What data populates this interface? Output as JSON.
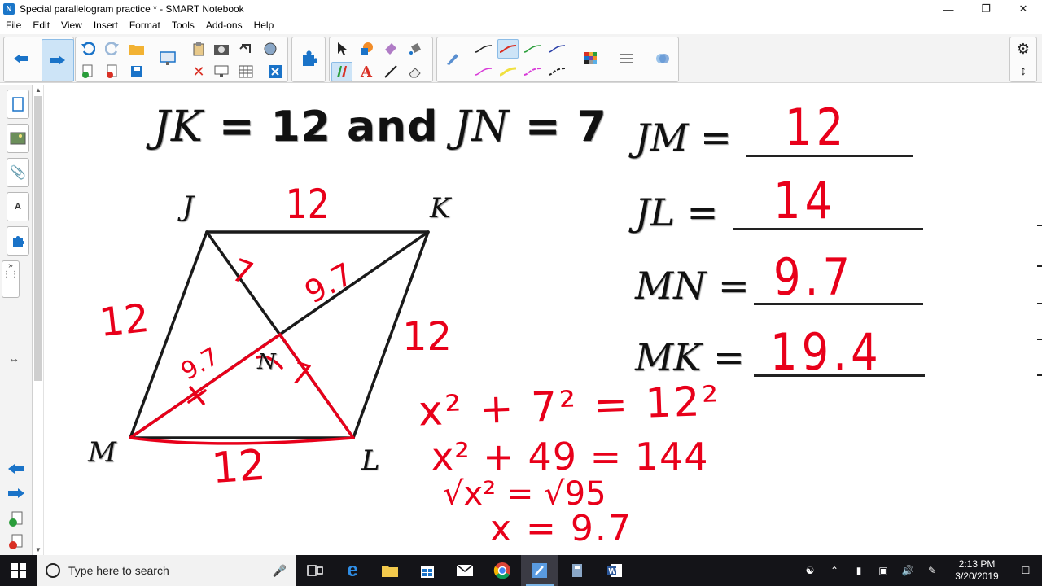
{
  "window": {
    "title": "Special parallelogram practice * - SMART Notebook",
    "icon": "smart-notebook-icon",
    "controls": [
      "minimize-icon",
      "restore-icon",
      "close-icon"
    ]
  },
  "menu": [
    "File",
    "Edit",
    "View",
    "Insert",
    "Format",
    "Tools",
    "Add-ons",
    "Help"
  ],
  "toolbar": {
    "buttons": [
      "previous-page",
      "next-page",
      "undo",
      "redo",
      "open",
      "add-page",
      "delete-page",
      "save",
      "screen-shade",
      "paste",
      "delete",
      "screen-capture",
      "table",
      "full-screen",
      "add-ons",
      "select",
      "shapes",
      "eraser",
      "fill",
      "pen",
      "text",
      "line",
      "magic-pen",
      "pens",
      "color-palette",
      "properties",
      "customize"
    ],
    "accent": "#1a73c8"
  },
  "canvas": {
    "given": {
      "left": "JK",
      "eq1": "= 12 and",
      "right": "JN",
      "eq2": "= 7"
    },
    "equations": [
      {
        "label": "JM",
        "eq": "=",
        "answer": "12"
      },
      {
        "label": "JL",
        "eq": "=",
        "answer": "14"
      },
      {
        "label": "MN",
        "eq": "=",
        "answer": "9.7"
      },
      {
        "label": "MK",
        "eq": "=",
        "answer": "19.4"
      }
    ],
    "vertices": {
      "J": "J",
      "K": "K",
      "L": "L",
      "M": "M",
      "N": "N"
    },
    "handwriting": {
      "side_top": "12",
      "side_left": "12",
      "side_right": "12",
      "side_bottom": "12",
      "seg_jn": "7",
      "seg_nl": "7",
      "seg_nk": "9.7",
      "seg_mn": "9.7",
      "work": [
        "x² + 7² = 12²",
        "x² + 49 = 144",
        "√x² = √95",
        "x = 9.7"
      ]
    },
    "ink_color": "#e8001a"
  },
  "taskbar": {
    "search_placeholder": "Type here to search",
    "time": "2:13 PM",
    "date": "3/20/2019",
    "apps": [
      "task-view",
      "edge",
      "file-explorer",
      "store",
      "mail",
      "chrome",
      "smart-notebook",
      "smart-tool",
      "word"
    ]
  }
}
